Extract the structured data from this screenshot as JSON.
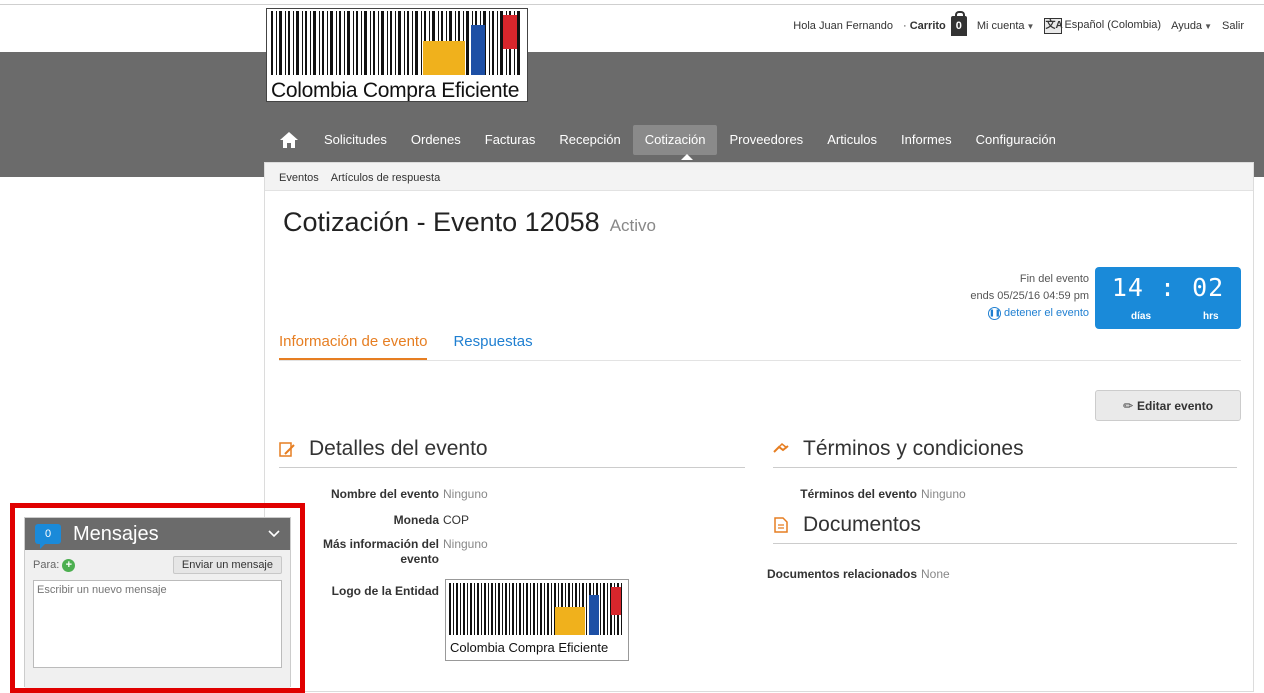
{
  "header": {
    "logo_text": "Colombia Compra Eficiente",
    "greeting": "Hola Juan Fernando",
    "cart_label": "Carrito",
    "cart_count": "0",
    "account_label": "Mi cuenta",
    "language_label": "Español (Colombia)",
    "help_label": "Ayuda",
    "logout_label": "Salir"
  },
  "nav": {
    "items": [
      "Solicitudes",
      "Ordenes",
      "Facturas",
      "Recepción",
      "Cotización",
      "Proveedores",
      "Articulos",
      "Informes",
      "Configuración"
    ],
    "active_index": 4
  },
  "breadcrumb": [
    "Eventos",
    "Artículos de respuesta"
  ],
  "page": {
    "title": "Cotización  - Evento 12058",
    "status": "Activo",
    "event_end_label": "Fin del evento",
    "event_end_date": "ends 05/25/16 04:59 pm",
    "stop_event_label": "detener el evento"
  },
  "timer": {
    "days": "14",
    "hours": "02",
    "days_label": "días",
    "hours_label": "hrs",
    "accent_color": "#1a8ad9"
  },
  "tabs": [
    "Información de evento",
    "Respuestas"
  ],
  "edit_button_label": "Editar evento",
  "details": {
    "heading": "Detalles del evento",
    "fields": [
      {
        "label": "Nombre del evento",
        "value": "Ninguno"
      },
      {
        "label": "Moneda",
        "value": "COP"
      },
      {
        "label": "Más información del evento",
        "value": "Ninguno"
      },
      {
        "label": "Logo de la Entidad",
        "value": ""
      }
    ]
  },
  "terms": {
    "heading": "Términos y condiciones",
    "fields": [
      {
        "label": "Términos del evento",
        "value": "Ninguno"
      }
    ]
  },
  "documents": {
    "heading": "Documentos",
    "fields": [
      {
        "label": "Documentos relacionados",
        "value": "None"
      }
    ]
  },
  "messages": {
    "count": "0",
    "title": "Mensajes",
    "to_label": "Para:",
    "send_button": "Enviar un mensaje",
    "placeholder": "Escribir un nuevo mensaje"
  }
}
